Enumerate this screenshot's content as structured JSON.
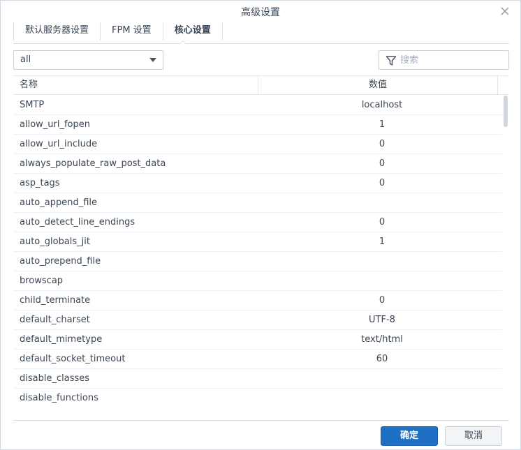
{
  "window": {
    "title": "高级设置"
  },
  "tabs": [
    {
      "label": "默认服务器设置"
    },
    {
      "label": "FPM 设置"
    },
    {
      "label": "核心设置",
      "active": true
    }
  ],
  "filter": {
    "selected": "all"
  },
  "search": {
    "placeholder": "搜索"
  },
  "table": {
    "columns": [
      "名称",
      "数值"
    ],
    "rows": [
      {
        "name": "SMTP",
        "value": "localhost"
      },
      {
        "name": "allow_url_fopen",
        "value": "1"
      },
      {
        "name": "allow_url_include",
        "value": "0"
      },
      {
        "name": "always_populate_raw_post_data",
        "value": "0"
      },
      {
        "name": "asp_tags",
        "value": "0"
      },
      {
        "name": "auto_append_file",
        "value": ""
      },
      {
        "name": "auto_detect_line_endings",
        "value": "0"
      },
      {
        "name": "auto_globals_jit",
        "value": "1"
      },
      {
        "name": "auto_prepend_file",
        "value": ""
      },
      {
        "name": "browscap",
        "value": ""
      },
      {
        "name": "child_terminate",
        "value": "0"
      },
      {
        "name": "default_charset",
        "value": "UTF-8"
      },
      {
        "name": "default_mimetype",
        "value": "text/html"
      },
      {
        "name": "default_socket_timeout",
        "value": "60"
      },
      {
        "name": "disable_classes",
        "value": ""
      },
      {
        "name": "disable_functions",
        "value": ""
      }
    ]
  },
  "buttons": {
    "ok": "确定",
    "cancel": "取消"
  },
  "icons": {
    "close": "close-icon",
    "filter": "funnel-icon",
    "dropdown": "chevron-down-icon"
  },
  "colors": {
    "primary": "#1f6fc5",
    "text": "#3a4656",
    "border": "#c7cfd8"
  }
}
